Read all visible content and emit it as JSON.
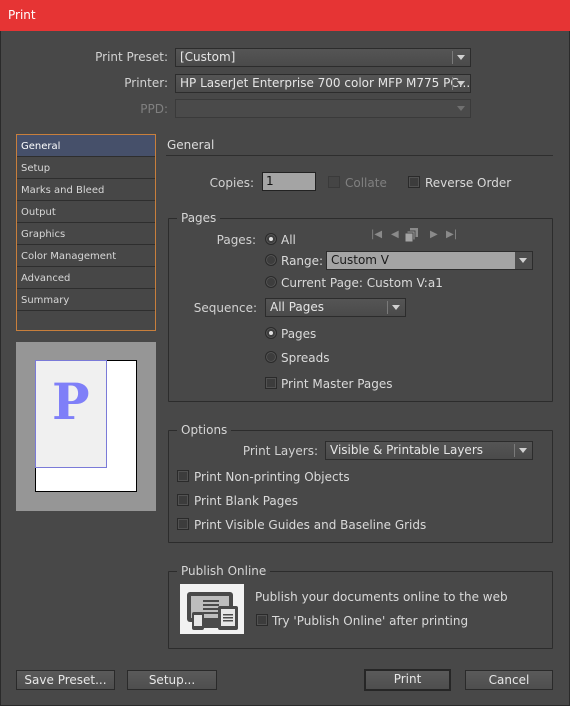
{
  "window": {
    "title": "Print"
  },
  "header": {
    "print_preset": {
      "label": "Print Preset:",
      "value": "[Custom]"
    },
    "printer": {
      "label": "Printer:",
      "value": "HP LaserJet Enterprise 700 color MFP M775 PC..."
    },
    "ppd": {
      "label": "PPD:",
      "value": ""
    }
  },
  "sidebar": {
    "items": [
      {
        "label": "General",
        "active": true
      },
      {
        "label": "Setup"
      },
      {
        "label": "Marks and Bleed"
      },
      {
        "label": "Output"
      },
      {
        "label": "Graphics"
      },
      {
        "label": "Color Management"
      },
      {
        "label": "Advanced"
      },
      {
        "label": "Summary"
      }
    ]
  },
  "preview": {
    "glyph": "P"
  },
  "general": {
    "title": "General",
    "copies_label": "Copies:",
    "copies_value": "1",
    "collate_label": "Collate",
    "collate_checked": false,
    "collate_enabled": false,
    "reverse_order_label": "Reverse Order",
    "reverse_order_checked": false
  },
  "pages": {
    "title": "Pages",
    "pages_label": "Pages:",
    "all_label": "All",
    "range_label": "Range:",
    "range_value": "Custom V",
    "current_page_label": "Current Page: Custom V:a1",
    "selected": "All",
    "nav_icons": [
      "first-page-icon",
      "previous-page-icon",
      "pages-icon",
      "next-page-icon",
      "last-page-icon"
    ],
    "sequence_label": "Sequence:",
    "sequence_value": "All Pages",
    "pages_option": "Pages",
    "spreads_option": "Spreads",
    "layout_selected": "Pages",
    "print_master_pages_label": "Print Master Pages",
    "print_master_pages_checked": false
  },
  "options": {
    "title": "Options",
    "print_layers_label": "Print Layers:",
    "print_layers_value": "Visible & Printable Layers",
    "checkboxes": [
      {
        "label": "Print Non-printing Objects",
        "checked": false
      },
      {
        "label": "Print Blank Pages",
        "checked": false
      },
      {
        "label": "Print Visible Guides and Baseline Grids",
        "checked": false
      }
    ]
  },
  "publish": {
    "title": "Publish Online",
    "description": "Publish your documents online to the web",
    "try_label": "Try 'Publish Online' after printing",
    "try_checked": false
  },
  "footer": {
    "save_preset": "Save Preset...",
    "setup": "Setup...",
    "print": "Print",
    "cancel": "Cancel"
  }
}
